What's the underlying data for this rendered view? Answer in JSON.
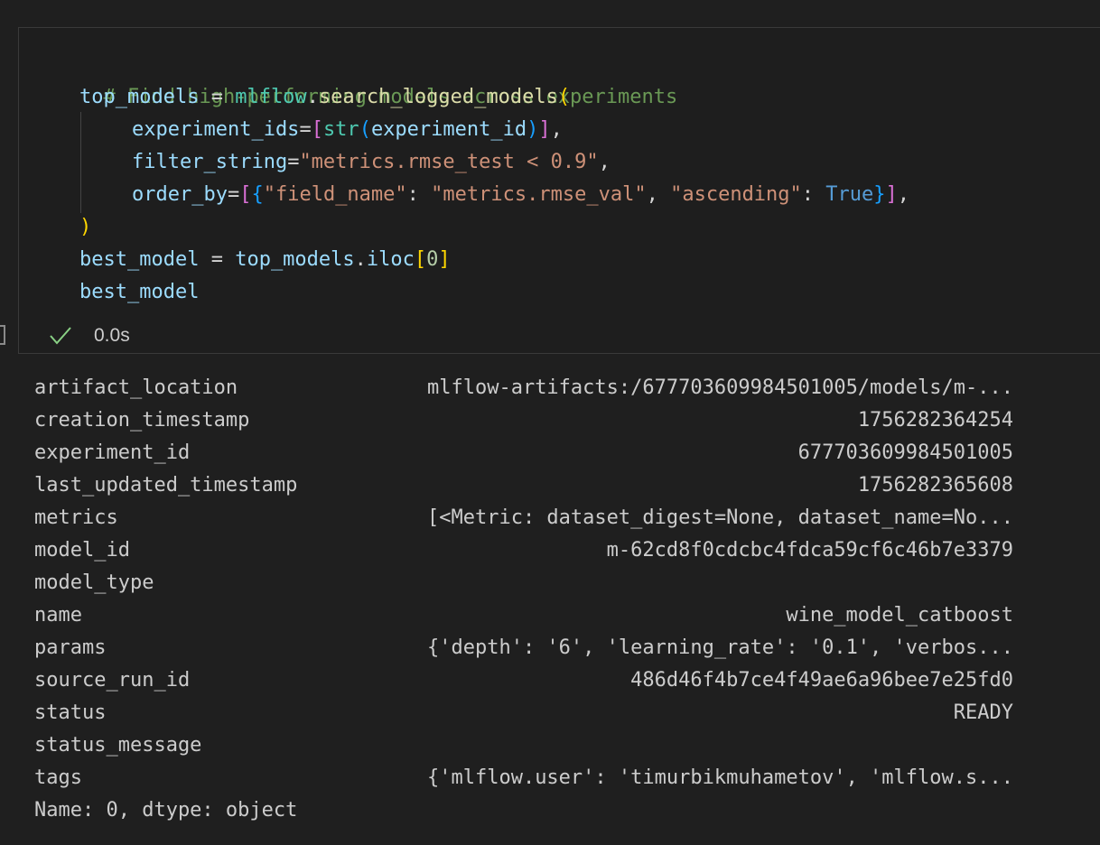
{
  "code": {
    "comment": "# Find high-performing models across experiments",
    "line2": {
      "var": "top_models",
      "eq": " = ",
      "module": "mlflow",
      "dot": ".",
      "fn": "search_logged_models",
      "paren": "("
    },
    "line3": {
      "param": "experiment_ids",
      "eq": "=",
      "lb": "[",
      "fn": "str",
      "lp": "(",
      "arg": "experiment_id",
      "rp": ")",
      "rb": "]",
      "comma": ","
    },
    "line4": {
      "param": "filter_string",
      "eq": "=",
      "str": "\"metrics.rmse_test < 0.9\"",
      "comma": ","
    },
    "line5": {
      "param": "order_by",
      "eq": "=",
      "lb": "[",
      "lc": "{",
      "k1": "\"field_name\"",
      "colon1": ": ",
      "v1": "\"metrics.rmse_val\"",
      "sep": ", ",
      "k2": "\"ascending\"",
      "colon2": ": ",
      "v2": "True",
      "rc": "}",
      "rb": "]",
      "comma": ","
    },
    "line6": {
      "paren": ")"
    },
    "line7": {
      "var": "best_model",
      "eq": " = ",
      "obj": "top_models",
      "dot": ".",
      "attr": "iloc",
      "lb": "[",
      "idx": "0",
      "rb": "]"
    },
    "line8": {
      "var": "best_model"
    }
  },
  "execution": {
    "status_icon": "check-icon",
    "time": "0.0s"
  },
  "output": {
    "rows": [
      {
        "key": "artifact_location",
        "value": "mlflow-artifacts:/677703609984501005/models/m-..."
      },
      {
        "key": "creation_timestamp",
        "value": "1756282364254"
      },
      {
        "key": "experiment_id",
        "value": "677703609984501005"
      },
      {
        "key": "last_updated_timestamp",
        "value": "1756282365608"
      },
      {
        "key": "metrics",
        "value": "[<Metric: dataset_digest=None, dataset_name=No..."
      },
      {
        "key": "model_id",
        "value": "m-62cd8f0cdcbc4fdca59cf6c46b7e3379"
      },
      {
        "key": "model_type",
        "value": ""
      },
      {
        "key": "name",
        "value": "wine_model_catboost"
      },
      {
        "key": "params",
        "value": "{'depth': '6', 'learning_rate': '0.1', 'verbos..."
      },
      {
        "key": "source_run_id",
        "value": "486d46f4b7ce4f49ae6a96bee7e25fd0"
      },
      {
        "key": "status",
        "value": "READY"
      },
      {
        "key": "status_message",
        "value": ""
      },
      {
        "key": "tags",
        "value": "{'mlflow.user': 'timurbikmuhametov', 'mlflow.s..."
      }
    ],
    "footer": "Name: 0, dtype: object"
  },
  "colors": {
    "background": "#1f1f1f",
    "comment": "#6a9955",
    "variable": "#9cdcfe",
    "function": "#dcdcaa",
    "module": "#4ec9b0",
    "string": "#ce9178",
    "number": "#b5cea8",
    "keyword": "#569cd6",
    "success": "#89d185"
  }
}
